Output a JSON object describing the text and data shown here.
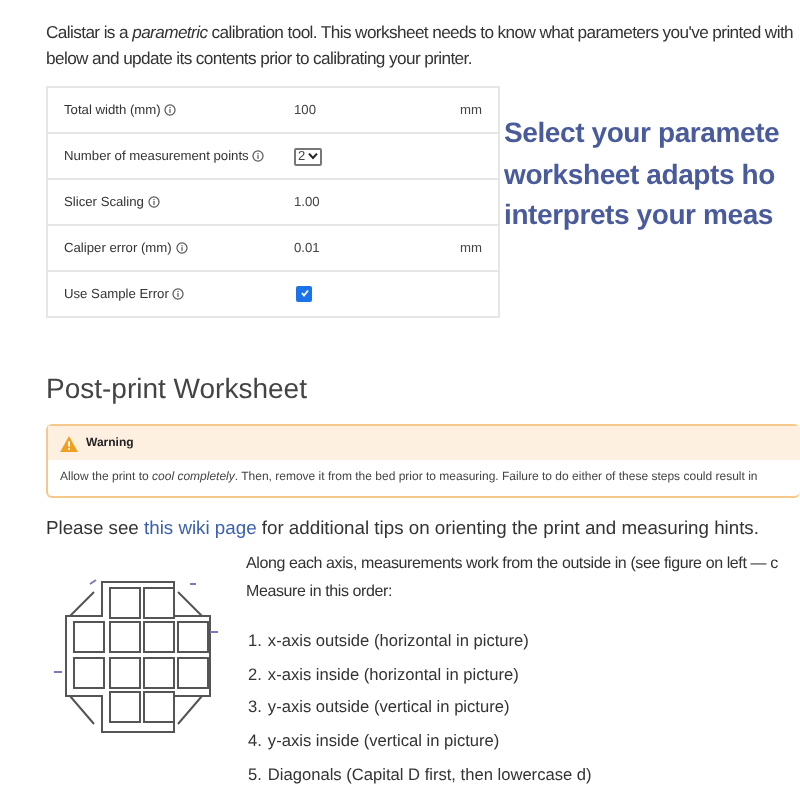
{
  "intro_lines": [
    "Calistar is a *parametric* calibration tool. This worksheet needs to know what parameters you've printed with",
    "below and update its contents prior to calibrating your printer."
  ],
  "parameters": [
    {
      "label": "Total width (mm)",
      "kind": "number",
      "value": "100",
      "unit": "mm"
    },
    {
      "label": "Number of measurement points",
      "kind": "select",
      "value": "2"
    },
    {
      "label": "Slicer Scaling",
      "kind": "number",
      "value": "1.00"
    },
    {
      "label": "Caliper error (mm)",
      "kind": "number",
      "value": "0.01",
      "unit": "mm"
    },
    {
      "label": "Use Sample Error",
      "kind": "checkbox",
      "checked": true
    }
  ],
  "callout_lines": [
    "Select your paramete",
    "worksheet adapts ho",
    "interprets your meas"
  ],
  "section_title": "Post-print Worksheet",
  "warning": {
    "title": "Warning",
    "body": "Allow the print to *cool completely*. Then, remove it from the bed prior to measuring. Failure to do either of these steps could result in"
  },
  "wiki_note": {
    "before": "Please see",
    "link": "this wiki page",
    "after": "for additional tips on orienting the print and measuring hints."
  },
  "instructions": [
    "Along each axis, measurements work from the outside in (see figure on left — c",
    "Measure in this order:"
  ],
  "steps": [
    {
      "number": "1.",
      "text": "x-axis outside (horizontal in picture)"
    },
    {
      "number": "2.",
      "text": "x-axis inside (horizontal in picture)"
    },
    {
      "number": "3.",
      "text": "y-axis outside (vertical in picture)"
    },
    {
      "number": "4.",
      "text": "y-axis inside (vertical in picture)"
    },
    {
      "number": "5.",
      "text": "Diagonals (Capital D first, then lowercase d)"
    }
  ]
}
